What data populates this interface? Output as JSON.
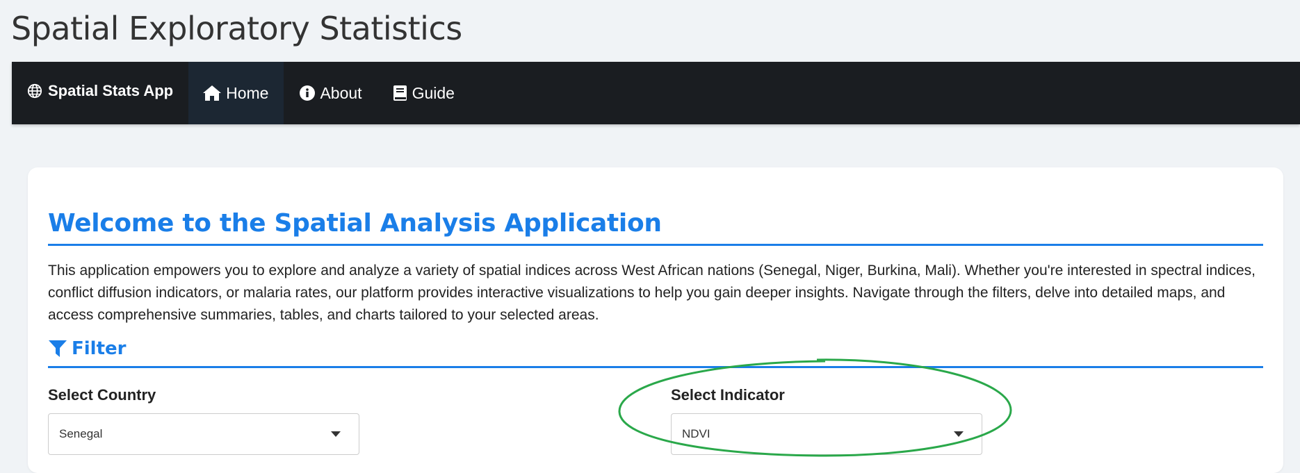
{
  "page_title": "Spatial Exploratory Statistics",
  "navbar": {
    "brand": "Spatial Stats App",
    "items": [
      {
        "label": "Home",
        "icon": "home-icon",
        "active": true
      },
      {
        "label": "About",
        "icon": "info-icon",
        "active": false
      },
      {
        "label": "Guide",
        "icon": "book-icon",
        "active": false
      }
    ]
  },
  "main": {
    "heading": "Welcome to the Spatial Analysis Application",
    "intro": "This application empowers you to explore and analyze a variety of spatial indices across West African nations (Senegal, Niger, Burkina, Mali). Whether you're interested in spectral indices, conflict diffusion indicators, or malaria rates, our platform provides interactive visualizations to help you gain deeper insights. Navigate through the filters, delve into detailed maps, and access comprehensive summaries, tables, and charts tailored to your selected areas.",
    "filter": {
      "title": "Filter",
      "country": {
        "label": "Select Country",
        "value": "Senegal"
      },
      "indicator": {
        "label": "Select Indicator",
        "value": "NDVI"
      }
    }
  },
  "colors": {
    "accent": "#1a7ee8",
    "navbar": "#1a1d21",
    "highlight": "#2aa84a"
  }
}
